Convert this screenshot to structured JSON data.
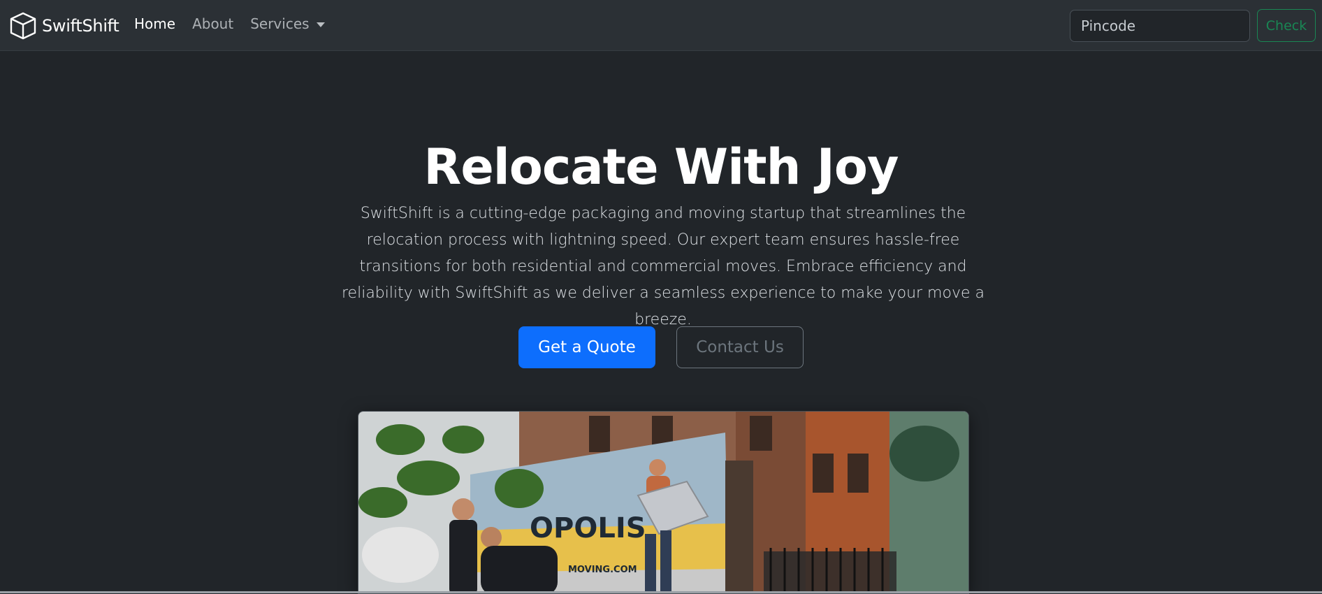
{
  "brand": {
    "name": "SwiftShift",
    "icon": "box-icon"
  },
  "nav": {
    "items": [
      {
        "label": "Home",
        "active": true
      },
      {
        "label": "About",
        "active": false
      }
    ],
    "dropdown": {
      "label": "Services",
      "icon": "caret-down-icon"
    }
  },
  "search": {
    "placeholder": "Pincode",
    "value": "",
    "button_label": "Check"
  },
  "hero": {
    "title": "Relocate With Joy",
    "lead": "SwiftShift is a cutting-edge packaging and moving startup that streamlines the relocation process with lightning speed. Our expert team ensures hassle-free transitions for both residential and commercial moves. Embrace efficiency and reliability with SwiftShift as we deliver a seamless experience to make your move a breeze.",
    "primary_button": "Get a Quote",
    "secondary_button": "Contact Us",
    "image": {
      "truck_text_1": "OPOLIS",
      "truck_text_2": "MOVING.COM"
    }
  },
  "colors": {
    "page_bg": "#212529",
    "navbar_bg": "#2b3035",
    "primary": "#0d6efd",
    "success": "#198754",
    "secondary": "#6c757d"
  }
}
